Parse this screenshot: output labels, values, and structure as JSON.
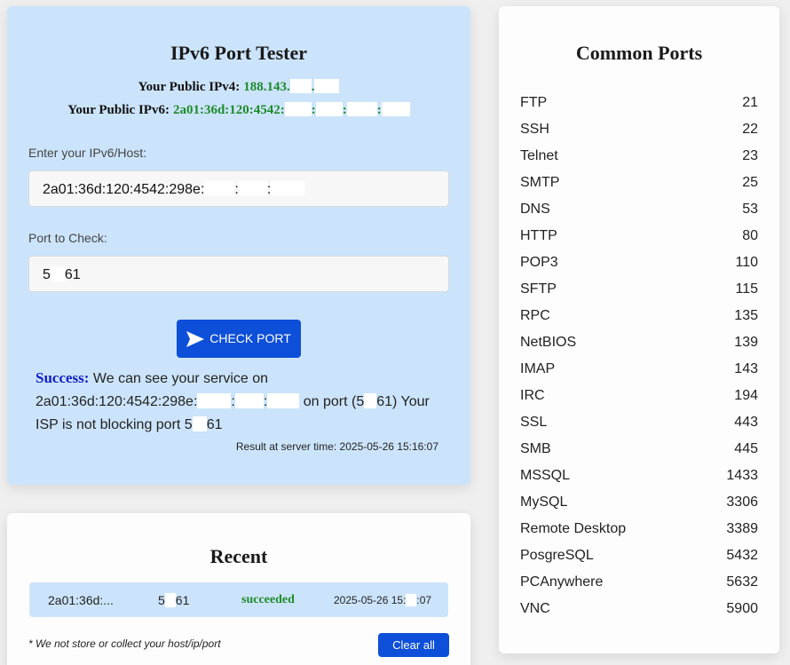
{
  "tester": {
    "title": "IPv6 Port Tester",
    "ipv4_label": "Your Public IPv4:",
    "ipv4_value": "188.143.",
    "ipv6_label": "Your Public IPv6:",
    "ipv6_value": "2a01:36d:120:4542:",
    "host_label": "Enter your IPv6/Host:",
    "host_value": "2a01:36d:120:4542:298e:",
    "port_label": "Port to Check:",
    "port_value_a": "5",
    "port_value_b": "61",
    "check_button": "CHECK PORT",
    "result_status": "Success:",
    "result_text_1": "We can see your service on",
    "result_host": "2a01:36d:120:4542:298e:",
    "result_text_2": "on port (5",
    "result_text_3": "61) Your ISP is not blocking port 5",
    "result_text_4": "61",
    "server_time": "Result at server time: 2025-05-26 15:16:07"
  },
  "recent": {
    "title": "Recent",
    "row": {
      "host": "2a01:36d:...",
      "port_a": "5",
      "port_b": "61",
      "status": "succeeded",
      "time_a": "2025-05-26 15:",
      "time_b": ":07"
    },
    "note": "* We not store or collect your host/ip/port",
    "clear_button": "Clear all"
  },
  "common_ports": {
    "title": "Common Ports",
    "items": [
      {
        "name": "FTP",
        "port": "21"
      },
      {
        "name": "SSH",
        "port": "22"
      },
      {
        "name": "Telnet",
        "port": "23"
      },
      {
        "name": "SMTP",
        "port": "25"
      },
      {
        "name": "DNS",
        "port": "53"
      },
      {
        "name": "HTTP",
        "port": "80"
      },
      {
        "name": "POP3",
        "port": "110"
      },
      {
        "name": "SFTP",
        "port": "115"
      },
      {
        "name": "RPC",
        "port": "135"
      },
      {
        "name": "NetBIOS",
        "port": "139"
      },
      {
        "name": "IMAP",
        "port": "143"
      },
      {
        "name": "IRC",
        "port": "194"
      },
      {
        "name": "SSL",
        "port": "443"
      },
      {
        "name": "SMB",
        "port": "445"
      },
      {
        "name": "MSSQL",
        "port": "1433"
      },
      {
        "name": "MySQL",
        "port": "3306"
      },
      {
        "name": "Remote Desktop",
        "port": "3389"
      },
      {
        "name": "PosgreSQL",
        "port": "5432"
      },
      {
        "name": "PCAnywhere",
        "port": "5632"
      },
      {
        "name": "VNC",
        "port": "5900"
      }
    ]
  },
  "colors": {
    "accent": "#0d4fd9",
    "panel": "#cce4fb",
    "success": "#1d8a2b",
    "status_blue": "#1020c8"
  },
  "icons": {
    "check_button_icon": "send-arrow-icon"
  }
}
